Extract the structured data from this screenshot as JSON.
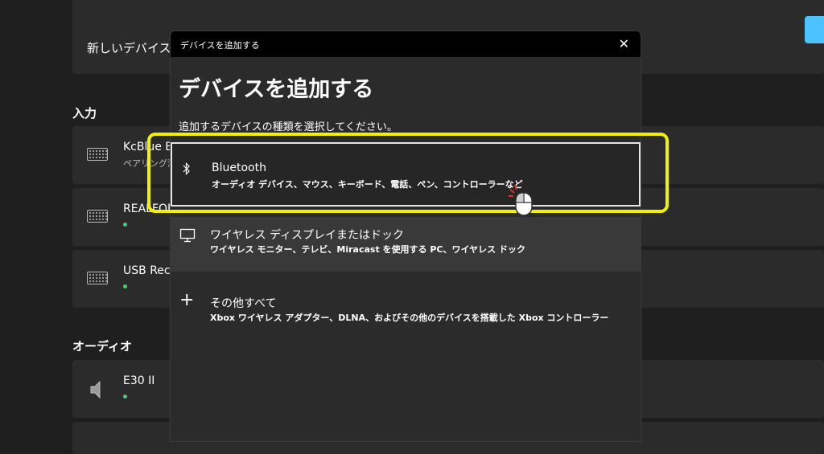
{
  "background": {
    "new_device_text": "新しいデバイスを \"",
    "sections": {
      "input": "入力",
      "audio": "オーディオ"
    },
    "devices": [
      {
        "name": "KcBlue B",
        "status": "ペアリング済"
      },
      {
        "name": "REALFOR",
        "status": ""
      },
      {
        "name": "USB Rece",
        "status": ""
      },
      {
        "name": "E30 II",
        "status": ""
      }
    ]
  },
  "dialog": {
    "titlebar": "デバイスを追加する",
    "heading": "デバイスを追加する",
    "subtitle": "追加するデバイスの種類を選択してください。",
    "options": [
      {
        "label": "Bluetooth",
        "description": "オーディオ デバイス、マウス、キーボード、電話、ペン、コントローラーなど",
        "icon": "bluetooth-icon"
      },
      {
        "label": "ワイヤレス ディスプレイまたはドック",
        "description": "ワイヤレス モニター、テレビ、Miracast を使用する PC、ワイヤレス ドック",
        "icon": "monitor-icon"
      },
      {
        "label": "その他すべて",
        "description": "Xbox ワイヤレス アダプター、DLNA、およびその他のデバイスを搭載した Xbox コントローラー",
        "icon": "plus-icon"
      }
    ]
  },
  "colors": {
    "accent": "#4cc2ff",
    "highlight": "#f2f200",
    "status_connected": "#4fc96f"
  }
}
